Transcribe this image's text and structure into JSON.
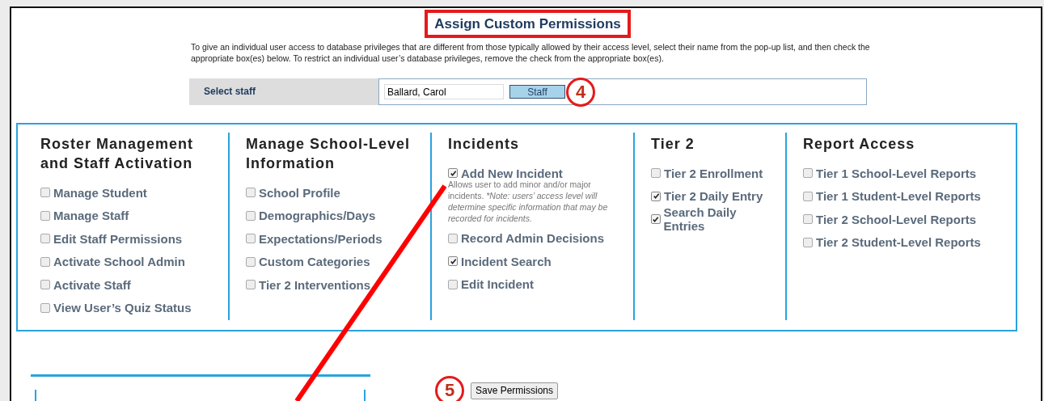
{
  "title": "Assign Custom Permissions",
  "description": "To give an individual user access to database privileges that are different from those typically allowed by their access level, select their name from the pop-up list, and then check the appropriate box(es) below. To restrict an individual user’s database privileges, remove the check from the appropriate box(es).",
  "staff": {
    "label": "Select staff",
    "value": "Ballard, Carol",
    "button": "Staff",
    "step": "4"
  },
  "groups": [
    {
      "heading": "Roster Management and Staff Activation",
      "items": [
        {
          "label": "Manage Student",
          "checked": false
        },
        {
          "label": "Manage Staff",
          "checked": false
        },
        {
          "label": "Edit Staff Permissions",
          "checked": false
        },
        {
          "label": "Activate School Admin",
          "checked": false
        },
        {
          "label": "Activate Staff",
          "checked": false
        },
        {
          "label": "View User’s Quiz Status",
          "checked": false
        }
      ]
    },
    {
      "heading": "Manage School-Level Information",
      "items": [
        {
          "label": "School Profile",
          "checked": false
        },
        {
          "label": "Demographics/Days",
          "checked": false
        },
        {
          "label": "Expectations/Periods",
          "checked": false
        },
        {
          "label": "Custom Categories",
          "checked": false
        },
        {
          "label": "Tier 2 Interventions",
          "checked": false
        }
      ]
    },
    {
      "heading": "Incidents",
      "items": [
        {
          "label": "Add New Incident",
          "checked": true,
          "note": {
            "text": "Allows user to add minor and/or major incidents.",
            "emphasis": "*Note: users’ access level will determine specific information that may be recorded for incidents."
          }
        },
        {
          "label": "Record Admin Decisions",
          "checked": false
        },
        {
          "label": "Incident Search",
          "checked": true
        },
        {
          "label": "Edit Incident",
          "checked": false
        }
      ]
    },
    {
      "heading": "Tier 2",
      "items": [
        {
          "label": "Tier 2 Enrollment",
          "checked": false
        },
        {
          "label": "Tier 2 Daily Entry",
          "checked": true
        },
        {
          "label": "Search Daily Entries",
          "checked": true
        }
      ]
    },
    {
      "heading": "Report Access",
      "items": [
        {
          "label": "Tier 1 School-Level Reports",
          "checked": false
        },
        {
          "label": "Tier 1 Student-Level Reports",
          "checked": false
        },
        {
          "label": "Tier 2 School-Level Reports",
          "checked": false
        },
        {
          "label": "Tier 2 Student-Level Reports",
          "checked": false
        }
      ]
    }
  ],
  "save": {
    "step": "5",
    "button": "Save Permissions"
  }
}
